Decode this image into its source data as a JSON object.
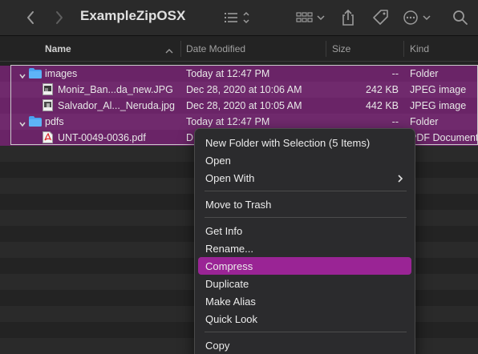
{
  "window": {
    "title": "ExampleZipOSX"
  },
  "toolbar": {
    "back_icon": "chevron-left-icon",
    "forward_icon": "chevron-right-icon",
    "view_icon": "list-view-icon",
    "group_icon": "grid-view-icon",
    "share_icon": "share-icon",
    "tag_icon": "tag-icon",
    "more_icon": "ellipsis-icon",
    "search_icon": "search-icon"
  },
  "columns": {
    "name": "Name",
    "date": "Date Modified",
    "size": "Size",
    "kind": "Kind"
  },
  "files": [
    {
      "name": "images",
      "date": "Today at 12:47 PM",
      "size": "--",
      "kind": "Folder",
      "type": "folder",
      "level": 0,
      "expanded": true
    },
    {
      "name": "Moniz_Ban...da_new.JPG",
      "date": "Dec 28, 2020 at 10:06 AM",
      "size": "242 KB",
      "kind": "JPEG image",
      "type": "image",
      "level": 1
    },
    {
      "name": "Salvador_Al..._Neruda.jpg",
      "date": "Dec 28, 2020 at 10:05 AM",
      "size": "442 KB",
      "kind": "JPEG image",
      "type": "image",
      "level": 1
    },
    {
      "name": "pdfs",
      "date": "Today at 12:47 PM",
      "size": "--",
      "kind": "Folder",
      "type": "folder",
      "level": 0,
      "expanded": true
    },
    {
      "name": "UNT-0049-0036.pdf",
      "date": "D",
      "size": "",
      "kind": "PDF Document",
      "type": "pdf",
      "level": 1
    }
  ],
  "context_menu": {
    "items": [
      {
        "label": "New Folder with Selection (5 Items)"
      },
      {
        "label": "Open"
      },
      {
        "label": "Open With",
        "submenu": true
      },
      {
        "label": "Move to Trash"
      },
      {
        "label": "Get Info"
      },
      {
        "label": "Rename..."
      },
      {
        "label": "Compress",
        "highlighted": true
      },
      {
        "label": "Duplicate"
      },
      {
        "label": "Make Alias"
      },
      {
        "label": "Quick Look"
      },
      {
        "label": "Copy"
      }
    ]
  },
  "colors": {
    "selection": "#6a2467",
    "highlight": "#9a2495",
    "folder": "#4aa3f0",
    "background": "#232323"
  }
}
